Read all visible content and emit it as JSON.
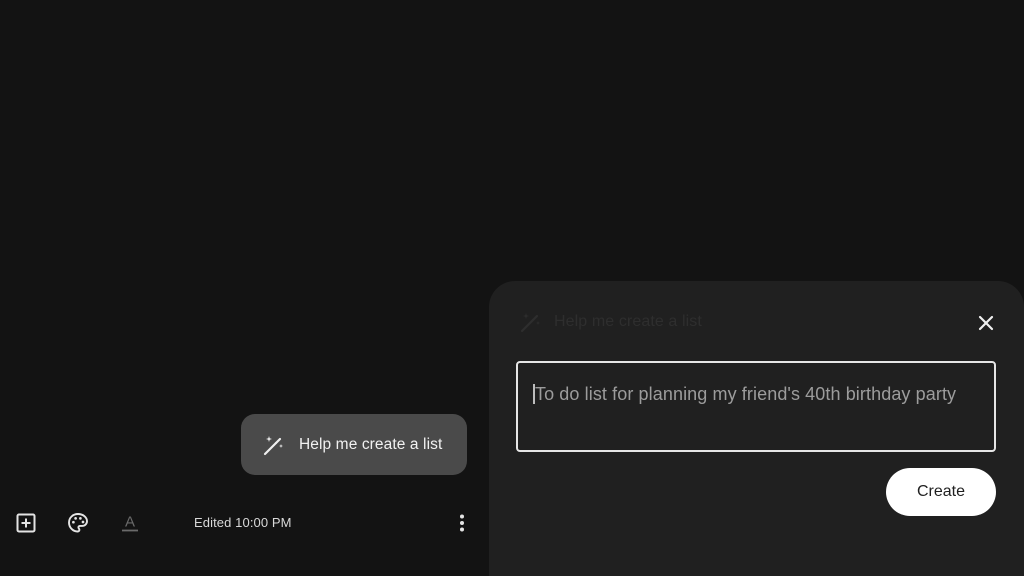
{
  "suggestion_chip": {
    "label": "Help me create a list",
    "icon": "magic-wand-icon"
  },
  "toolbar": {
    "add_icon": "add-box-icon",
    "palette_icon": "palette-icon",
    "text_format_icon": "text-format-icon",
    "text_format_glyph": "A",
    "edited_label": "Edited 10:00 PM",
    "more_icon": "more-vert-icon"
  },
  "panel": {
    "title": "Help me create a list",
    "icon": "magic-wand-icon",
    "close_icon": "close-icon",
    "prompt_value": "To do list for planning my friend's 40th birthday party",
    "create_label": "Create"
  },
  "colors": {
    "background": "#131313",
    "panel_background": "#202020",
    "chip_background": "#4a4a4a",
    "button_background": "#ffffff"
  }
}
